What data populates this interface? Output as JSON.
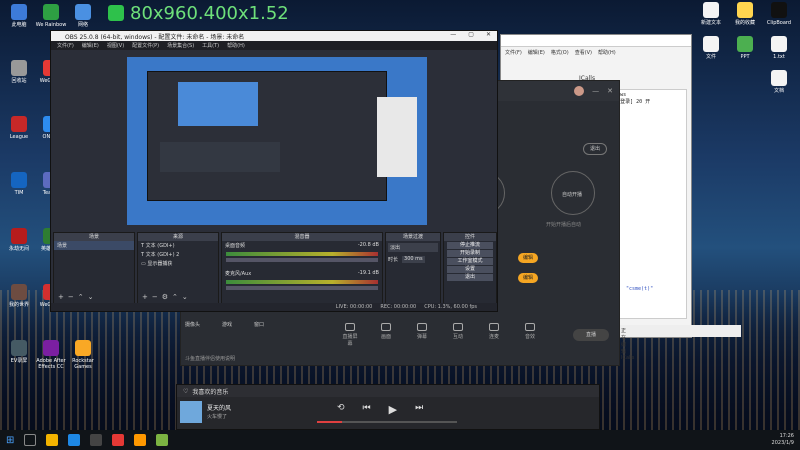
{
  "overlay_text": "80x960.400x1.52",
  "desktop": {
    "left_icons": [
      "此电脑",
      "We Rainbow",
      "网络",
      "回收站",
      "WeGame",
      "Steam",
      "League",
      "ONETA",
      "WeGame",
      "TIM",
      "TeamS",
      "哔哩",
      "永劫无间",
      "英雄联盟",
      "Epic Games Launcher",
      "我的世界",
      "WeGame",
      "全民K歌",
      "EV录屏",
      "Adobe After Effects CC",
      "Rockstar Games"
    ],
    "right_icons": [
      "新建文本",
      "我的收藏",
      "ClipBoard",
      "文件",
      "PPT",
      "1.txt",
      "文档"
    ]
  },
  "obs": {
    "title": "OBS 25.0.8 (64-bit, windows) - 配置文件: 未命名 - 场景: 未命名",
    "menu": [
      "文件(F)",
      "编辑(E)",
      "视图(V)",
      "配置文件(P)",
      "场景集合(S)",
      "工具(T)",
      "帮助(H)"
    ],
    "docks": {
      "scenes": {
        "title": "场景",
        "items": [
          "场景"
        ]
      },
      "sources": {
        "title": "来源",
        "items": [
          "文本 (GDI+)",
          "文本 (GDI+) 2",
          "显示器捕获"
        ]
      },
      "mixer": {
        "title": "混音器",
        "tracks": [
          {
            "name": "桌面音频",
            "db": "-20.8 dB"
          },
          {
            "name": "麦克风/Aux",
            "db": "-19.1 dB"
          }
        ]
      },
      "transitions": {
        "title": "场景过渡",
        "type": "淡出",
        "duration_label": "时长",
        "duration": "300 ms"
      },
      "controls": {
        "title": "控件",
        "buttons": [
          "停止推流",
          "开始录制",
          "工作室模式",
          "设置",
          "退出"
        ]
      }
    },
    "status": [
      "LIVE: 00:00:00",
      "REC: 00:00:00",
      "CPU: 1.3%, 60.00 fps"
    ]
  },
  "live_app": {
    "buttons": [
      "退出"
    ],
    "labels": [
      "启动开播",
      "开始开播后自动",
      "自动开播"
    ],
    "yellow_buttons": [
      "编辑",
      "编辑"
    ],
    "tools": [
      "直播屏幕",
      "画面",
      "弹幕",
      "互动",
      "连麦",
      "音效",
      "伴奏"
    ],
    "footer": "斗鱼直播伴侣使用说明",
    "sidebar": [
      "摄像头",
      "游戏",
      "窗口"
    ],
    "side_btn": "直播"
  },
  "music": {
    "header": "我喜欢的音乐",
    "track": "夏天的风",
    "artist": "火车慢了"
  },
  "notepad": {
    "title": "ICalls",
    "menu": [
      "文件(F)",
      "编辑(E)",
      "格式(O)",
      "查看(V)",
      "帮助(H)"
    ],
    "lines": [
      "[Studio] Windows",
      "[version] 50 [登录] 20 开"
    ],
    "status": "\"csme(t)\"",
    "footer": "正在编辑 ICalls"
  },
  "taskbar": {
    "time": "17:26",
    "date": "2023/1/9"
  }
}
